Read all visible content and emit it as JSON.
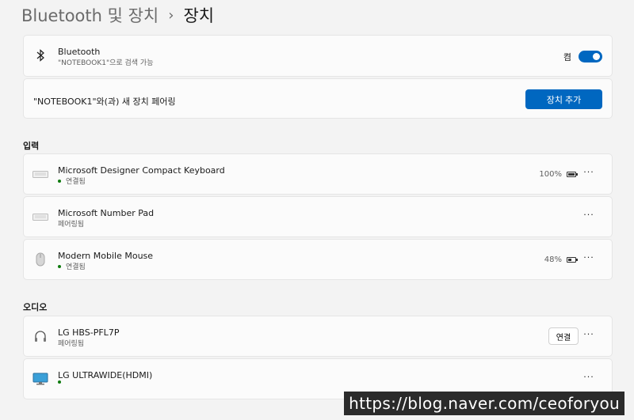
{
  "breadcrumb": {
    "parent": "Bluetooth 및 장치",
    "separator": "›",
    "current": "장치"
  },
  "bluetooth": {
    "title": "Bluetooth",
    "subtitle": "\"NOTEBOOK1\"으로 검색 가능",
    "toggle_label": "켬",
    "icon": "bluetooth-icon"
  },
  "pair": {
    "text": "\"NOTEBOOK1\"와(과) 새 장치 페어링",
    "button": "장치 추가"
  },
  "sections": {
    "input": "입력",
    "audio": "오디오"
  },
  "devices_input": [
    {
      "name": "Microsoft Designer Compact Keyboard",
      "status": "연결됨",
      "battery": "100%",
      "battery_level": 1.0,
      "icon": "keyboard-icon"
    },
    {
      "name": "Microsoft Number Pad",
      "status": "페어링됨",
      "icon": "keyboard-icon"
    },
    {
      "name": "Modern Mobile Mouse",
      "status": "연결됨",
      "battery": "48%",
      "battery_level": 0.48,
      "icon": "mouse-icon"
    }
  ],
  "devices_audio": [
    {
      "name": "LG HBS-PFL7P",
      "status": "페어링됨",
      "action": "연결",
      "icon": "headphones-icon"
    },
    {
      "name": "LG ULTRAWIDE(HDMI)",
      "status": "",
      "icon": "monitor-icon"
    }
  ],
  "more_label": "···",
  "watermark": "https://blog.naver.com/ceoforyou",
  "colors": {
    "accent": "#0067c0",
    "connected": "#0f7b0f",
    "background": "#f3f3f3"
  }
}
